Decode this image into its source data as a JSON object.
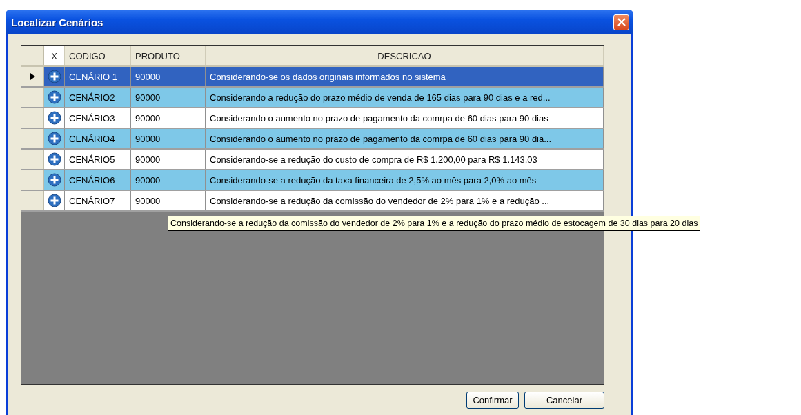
{
  "window": {
    "title": "Localizar Cenários"
  },
  "table": {
    "columns": [
      "X",
      "CODIGO",
      "PRODUTO",
      "DESCRICAO"
    ],
    "rows": [
      {
        "selected": true,
        "codigo": "CENÁRIO 1",
        "produto": "90000",
        "descricao": "Considerando-se os dados originais informados no sistema"
      },
      {
        "selected": false,
        "codigo": "CENÁRIO2",
        "produto": "90000",
        "descricao": "Considerando a redução do prazo médio de venda de 165 dias para 90 dias e a red..."
      },
      {
        "selected": false,
        "codigo": "CENÁRIO3",
        "produto": "90000",
        "descricao": "Considerando o aumento no prazo de pagamento da comrpa de 60 dias para 90 dias"
      },
      {
        "selected": false,
        "codigo": "CENÁRIO4",
        "produto": "90000",
        "descricao": "Considerando o aumento no prazo de pagamento da comrpa de 60 dias para 90 dia..."
      },
      {
        "selected": false,
        "codigo": "CENÁRIO5",
        "produto": "90000",
        "descricao": "Considerando-se a redução do custo de compra de R$ 1.200,00 para R$ 1.143,03"
      },
      {
        "selected": false,
        "codigo": "CENÁRIO6",
        "produto": "90000",
        "descricao": "Considerando-se a redução da taxa financeira de 2,5% ao mês para 2,0% ao mês"
      },
      {
        "selected": false,
        "codigo": "CENÁRIO7",
        "produto": "90000",
        "descricao": "Considerando-se a redução da comissão do vendedor de 2% para 1% e a redução ..."
      }
    ]
  },
  "tooltip": "Considerando-se a redução da comissão do vendedor de 2% para 1% e a redução do prazo médio de estocagem de 30 dias para 20 dias",
  "buttons": [
    "Confirmar",
    "Cancelar"
  ]
}
